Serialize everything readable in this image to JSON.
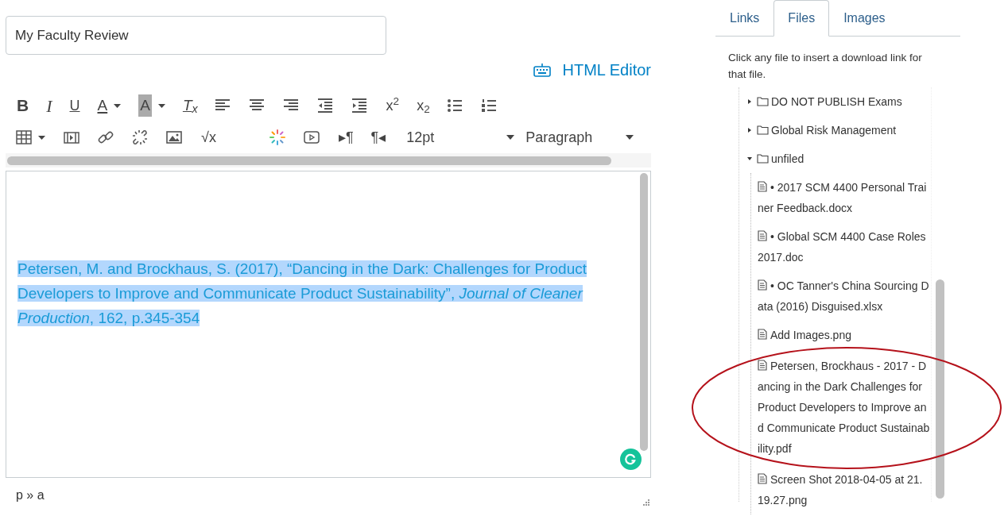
{
  "title_field": {
    "value": "My Faculty Review"
  },
  "html_editor_link": "HTML Editor",
  "toolbar": {
    "formatting": [
      {
        "kind": "bold",
        "label": "B"
      },
      {
        "kind": "italic",
        "label": "I"
      },
      {
        "kind": "underline",
        "label": "U"
      },
      {
        "kind": "text-color",
        "label": "A",
        "dropdown": true
      },
      {
        "kind": "highlight",
        "label": "A",
        "dropdown": true
      },
      {
        "kind": "clear-format",
        "label": "T$_{x}$"
      },
      {
        "kind": "align-left"
      },
      {
        "kind": "align-center"
      },
      {
        "kind": "align-right"
      },
      {
        "kind": "outdent"
      },
      {
        "kind": "indent"
      },
      {
        "kind": "plain",
        "label": "x$^{2}$"
      },
      {
        "kind": "plain",
        "label": "x$_{2}$"
      },
      {
        "kind": "bullet-list"
      },
      {
        "kind": "numbered-list"
      }
    ],
    "insert": [
      {
        "kind": "table",
        "dropdown": true
      },
      {
        "kind": "media"
      },
      {
        "kind": "link"
      },
      {
        "kind": "unlink"
      },
      {
        "kind": "image"
      },
      {
        "kind": "plain",
        "label": "√x"
      },
      {
        "kind": "apps"
      },
      {
        "kind": "video"
      },
      {
        "kind": "plain",
        "label": "▸¶"
      },
      {
        "kind": "plain",
        "label": "¶◂"
      },
      {
        "kind": "select",
        "label": "12pt"
      },
      {
        "kind": "select",
        "label": "Paragraph"
      }
    ]
  },
  "editor": {
    "paragraph": "Petersen, M. and Brockhaus, S. (2017), “Dancing in the Dark: Challenges for Product Developers to Improve and Communicate Product Sustainability”, *Journal of Cleaner Production*, 162, p.345-354",
    "selected": true
  },
  "status_bar": {
    "path": "p » a"
  },
  "sidebar": {
    "tabs": [
      {
        "label": "Links",
        "selected": false
      },
      {
        "label": "Files",
        "selected": true
      },
      {
        "label": "Images",
        "selected": false
      }
    ],
    "hint": "Click any file to insert a download link for that file.",
    "tree": [
      {
        "kind": "folder",
        "label": "DO NOT PUBLISH Exams",
        "expanded": false
      },
      {
        "kind": "folder",
        "label": "Global Risk Management",
        "expanded": false
      },
      {
        "kind": "folder",
        "label": "unfiled",
        "expanded": true,
        "children": [
          {
            "kind": "file",
            "lines": [
              "• 2017 SCM 4400 Personal Trai",
              "ner Feedback.docx"
            ],
            "circled": false
          },
          {
            "kind": "file",
            "lines": [
              "• Global SCM 4400 Case Roles",
              "2017.doc"
            ],
            "circled": false
          },
          {
            "kind": "file",
            "lines": [
              "• OC Tanner's China Sourcing D",
              "ata (2016) Disguised.xlsx"
            ],
            "circled": false
          },
          {
            "kind": "file",
            "lines": [
              "Add Images.png"
            ],
            "circled": false
          },
          {
            "kind": "file",
            "lines": [
              "Petersen, Brockhaus - 2017 - D",
              "ancing in the Dark Challenges for",
              "Product Developers to Improve an",
              "d Communicate Product Sustainab",
              "ility.pdf"
            ],
            "circled": true
          },
          {
            "kind": "file",
            "lines": [
              "Screen Shot 2018-04-05 at 21.",
              "19.27.png"
            ],
            "circled": false
          }
        ]
      }
    ]
  }
}
